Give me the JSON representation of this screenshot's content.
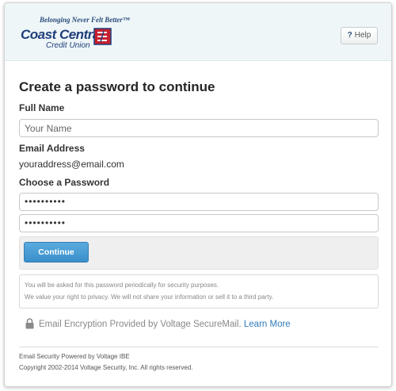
{
  "header": {
    "tagline": "Belonging Never Felt Better™",
    "logo_main": "Coast Central",
    "logo_sub": "Credit Union",
    "help_icon": "?",
    "help_label": "Help"
  },
  "form": {
    "title": "Create a password to continue",
    "full_name_label": "Full Name",
    "full_name_placeholder": "Your Name",
    "full_name_value": "",
    "email_label": "Email Address",
    "email_value": "youraddress@email.com",
    "password_label": "Choose a Password",
    "password_value": "••••••••••",
    "password_confirm_value": "••••••••••",
    "continue_label": "Continue"
  },
  "notice": {
    "line1": "You will be asked for this password periodically for security purposes.",
    "line2": "We value your right to privacy. We will not share your information or sell it to a third party."
  },
  "encryption": {
    "text": "Email Encryption Provided by Voltage SecureMail.",
    "link": "Learn More"
  },
  "footer": {
    "line1": "Email Security Powered by Voltage IBE",
    "line2": "Copyright 2002-2014 Voltage Security, Inc. All rights reserved."
  },
  "colors": {
    "brand_blue": "#1f3e7a",
    "brand_red": "#c8202f",
    "button_blue": "#3a8fcb",
    "link_blue": "#2f7bbd"
  }
}
